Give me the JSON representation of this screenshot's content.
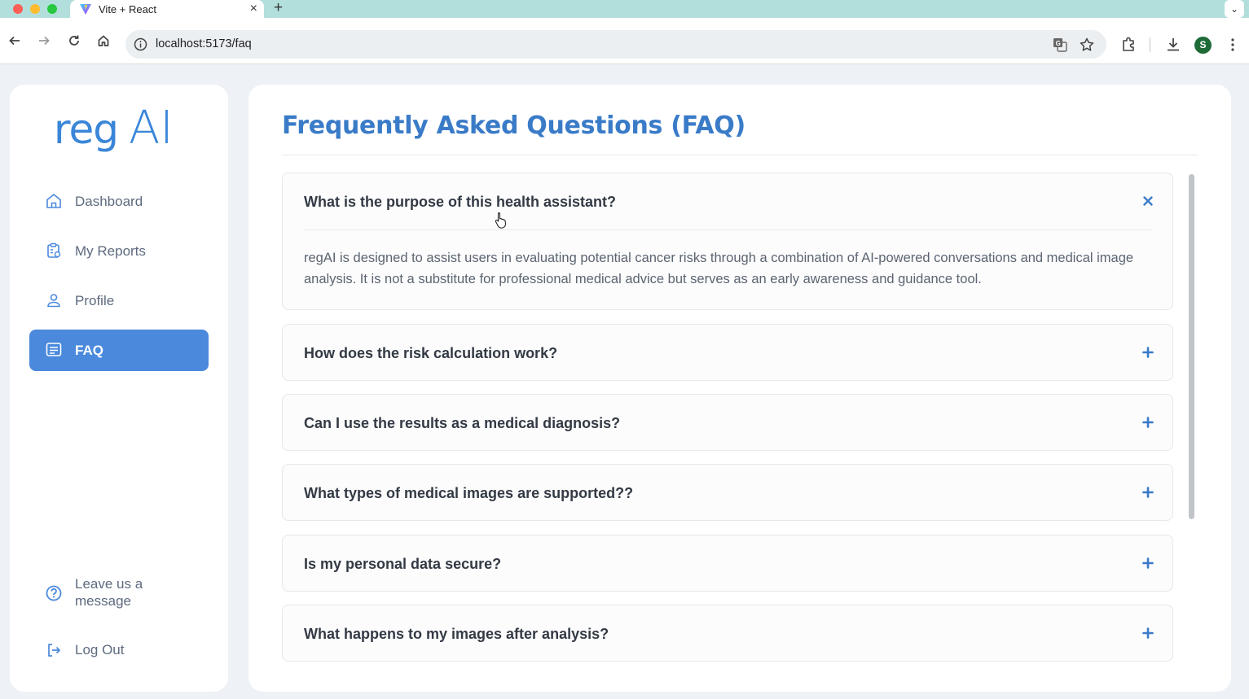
{
  "browser": {
    "tab_title": "Vite + React",
    "url": "localhost:5173/faq",
    "profile_initial": "S"
  },
  "brand": {
    "logo_text_part1": "reg",
    "logo_text_part2": "AI",
    "accent": "#4a89dc",
    "title_color": "#3a7bc8"
  },
  "sidebar": {
    "items": [
      {
        "label": "Dashboard",
        "icon": "home-icon",
        "active": false
      },
      {
        "label": "My Reports",
        "icon": "reports-icon",
        "active": false
      },
      {
        "label": "Profile",
        "icon": "user-icon",
        "active": false
      },
      {
        "label": "FAQ",
        "icon": "faq-icon",
        "active": true
      }
    ],
    "leave_message_line1": "Leave us a",
    "leave_message_line2": "message",
    "logout": "Log Out"
  },
  "main": {
    "title": "Frequently Asked Questions (FAQ)",
    "faqs": [
      {
        "question": "What is the purpose of this health assistant?",
        "expanded": true,
        "answer": "regAI is designed to assist users in evaluating potential cancer risks through a combination of AI-powered conversations and medical image analysis. It is not a substitute for professional medical advice but serves as an early awareness and guidance tool."
      },
      {
        "question": "How does the risk calculation work?",
        "expanded": false
      },
      {
        "question": "Can I use the results as a medical diagnosis?",
        "expanded": false
      },
      {
        "question": "What types of medical images are supported??",
        "expanded": false
      },
      {
        "question": "Is my personal data secure?",
        "expanded": false
      },
      {
        "question": "What happens to my images after analysis?",
        "expanded": false
      }
    ]
  }
}
